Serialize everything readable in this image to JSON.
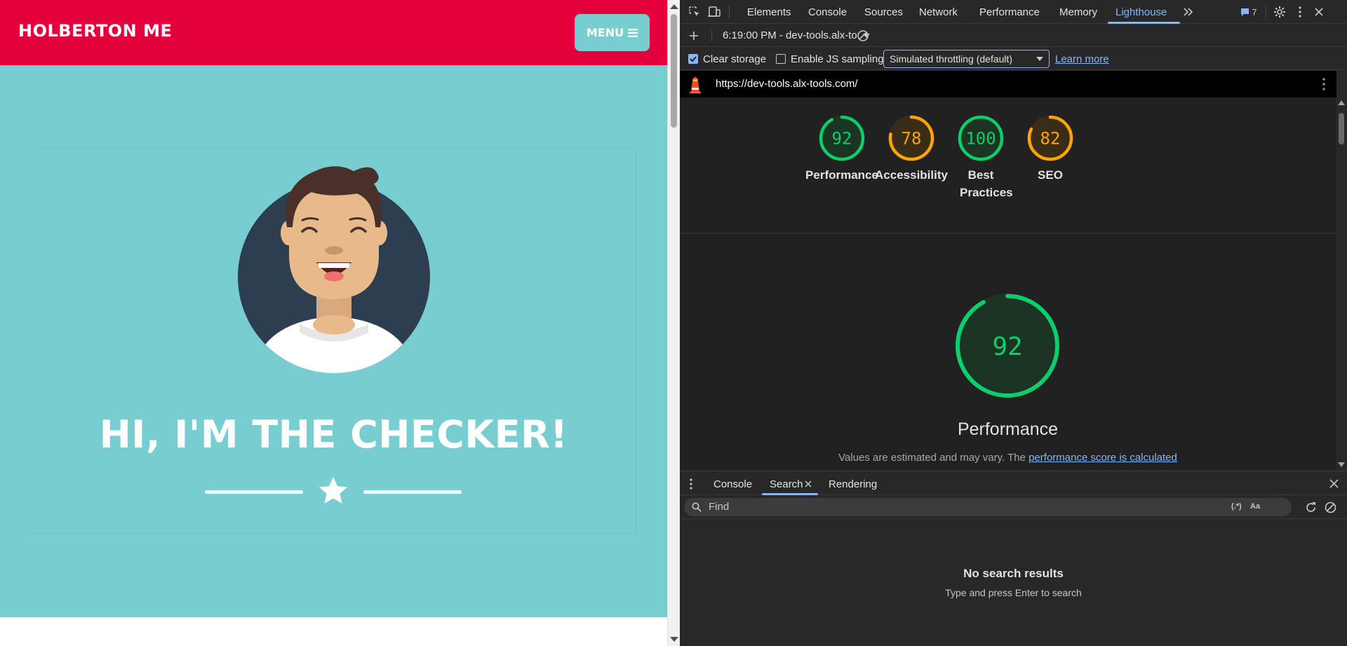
{
  "site": {
    "brand": "HOLBERTON ME",
    "menu_label": "MENU",
    "menu_icon": "hamburger-icon",
    "hero_title": "HI, I'M THE CHECKER!",
    "divider_icon": "star-icon",
    "colors": {
      "navbar": "#e4003a",
      "hero": "#78cdd1"
    }
  },
  "devtools": {
    "tabs": [
      "Elements",
      "Console",
      "Sources",
      "Network",
      "Performance",
      "Memory",
      "Lighthouse"
    ],
    "active_tab": "Lighthouse",
    "issues_count": "7",
    "toolbar": {
      "report_label": "6:19:00 PM - dev-tools.alx-to"
    },
    "options": {
      "clear_storage": {
        "label": "Clear storage",
        "checked": true
      },
      "js_sampling": {
        "label": "Enable JS sampling",
        "checked": false
      },
      "throttling": "Simulated throttling (default)",
      "learn_more": "Learn more"
    },
    "url": "https://dev-tools.alx-tools.com/",
    "scores": [
      {
        "label": "Performance",
        "score": 92,
        "color": "#0cce6b"
      },
      {
        "label": "Accessibility",
        "score": 78,
        "color": "#ffa400"
      },
      {
        "label": "Best Practices",
        "score": 100,
        "color": "#0cce6b"
      },
      {
        "label": "SEO",
        "score": 82,
        "color": "#ffa400"
      }
    ],
    "performance": {
      "score": 92,
      "title": "Performance",
      "note_prefix": "Values are estimated and may vary. The ",
      "note_link": "performance score is calculated"
    },
    "drawer": {
      "tabs": [
        "Console",
        "Search",
        "Rendering"
      ],
      "active_tab": "Search",
      "search_placeholder": "Find",
      "regex_label": "(.*)",
      "case_label": "Aa",
      "no_results": "No search results",
      "no_results_hint": "Type and press Enter to search"
    }
  }
}
